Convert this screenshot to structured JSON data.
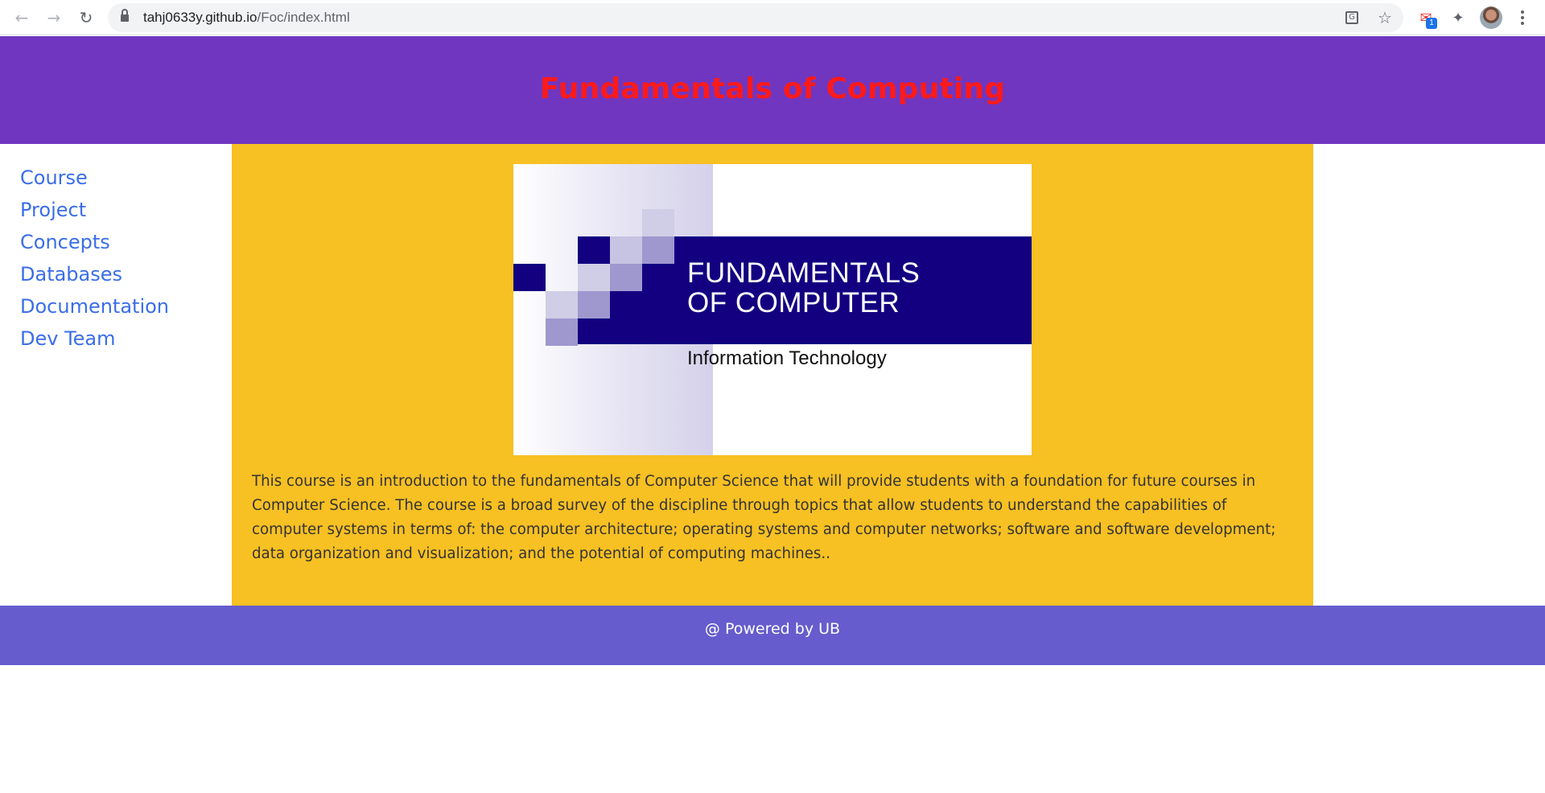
{
  "browser": {
    "url_host": "tahj0633y.github.io",
    "url_path": "/Foc/index.html",
    "extension_badge": "1",
    "icons": [
      "back-icon",
      "forward-icon",
      "reload-icon",
      "lock-icon",
      "translate-icon",
      "star-icon",
      "extension-icon",
      "puzzle-icon",
      "avatar",
      "menu-icon"
    ]
  },
  "header": {
    "title": "Fundamentals of Computing"
  },
  "sidebar": {
    "items": [
      {
        "label": "Course"
      },
      {
        "label": "Project"
      },
      {
        "label": "Concepts"
      },
      {
        "label": "Databases"
      },
      {
        "label": "Documentation"
      },
      {
        "label": "Dev Team"
      }
    ]
  },
  "main": {
    "banner": {
      "title": "FUNDAMENTALS\nOF COMPUTER",
      "subtitle": "Information Technology"
    },
    "description": "This course is an introduction to the fundamentals of Computer Science that will provide students with a foundation for future courses in Computer Science. The course is a broad survey of the discipline through topics that allow students to understand the capabilities of computer systems in terms of: the computer architecture; operating systems and computer networks; software and software development; data organization and visualization; and the potential of computing machines.."
  },
  "footer": {
    "text": "@ Powered by UB"
  },
  "colors": {
    "header_bg": "#7036c0",
    "title_color": "#ff1a1a",
    "link_color": "#3a6ee8",
    "main_bg": "#f7c023",
    "footer_bg": "#665ccd",
    "banner_bar": "#120080"
  }
}
